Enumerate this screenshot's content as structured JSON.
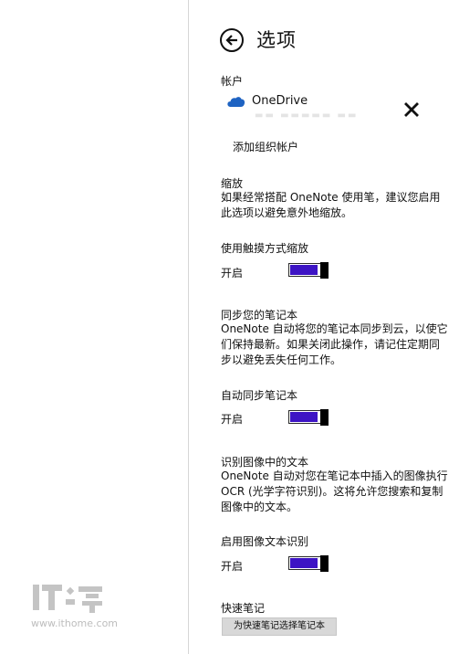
{
  "colors": {
    "toggle_on": "#3d14c4",
    "toggle_thumb": "#000000",
    "onedrive_blue": "#1e63c2",
    "watermark": "#bdbdbd"
  },
  "watermark": {
    "logo_text": "IT之家",
    "url": "www.ithome.com"
  },
  "header": {
    "back_icon": "back-arrow-circle-icon",
    "title": "选项"
  },
  "accounts": {
    "heading": "帐户",
    "service_icon": "onedrive-cloud-icon",
    "service_name": "OneDrive",
    "remove_icon": "close-icon",
    "add_org_account": "添加组织帐户"
  },
  "zoom": {
    "heading": "缩放",
    "description": "如果经常搭配 OneNote 使用笔，建议您启用此选项以避免意外地缩放。",
    "setting_label": "使用触摸方式缩放",
    "state_label": "开启",
    "on": true
  },
  "sync": {
    "heading": "同步您的笔记本",
    "description": "OneNote 自动将您的笔记本同步到云，以使它们保持最新。如果关闭此操作，请记住定期同步以避免丢失任何工作。",
    "setting_label": "自动同步笔记本",
    "state_label": "开启",
    "on": true
  },
  "ocr": {
    "heading": "识别图像中的文本",
    "description": "OneNote 自动对您在笔记本中插入的图像执行OCR (光学字符识别)。这将允许您搜索和复制图像中的文本。",
    "setting_label": "启用图像文本识别",
    "state_label": "开启",
    "on": true
  },
  "quick_notes": {
    "heading": "快速笔记",
    "button_label": "为快速笔记选择笔记本"
  }
}
